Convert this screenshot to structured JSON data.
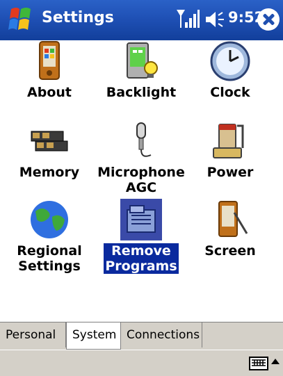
{
  "titlebar": {
    "title": "Settings",
    "time": "9:52"
  },
  "apps": [
    {
      "label": "About"
    },
    {
      "label": "Backlight"
    },
    {
      "label": "Clock"
    },
    {
      "label": "Memory"
    },
    {
      "label": "Microphone\nAGC"
    },
    {
      "label": "Power"
    },
    {
      "label": "Regional\nSettings"
    },
    {
      "label": "Remove\nPrograms",
      "selected": true
    },
    {
      "label": "Screen"
    }
  ],
  "tabs": [
    {
      "label": "Personal"
    },
    {
      "label": "System",
      "active": true
    },
    {
      "label": "Connections"
    }
  ],
  "colors": {
    "title_bar": "#1e4fb3",
    "selection": "#0a2a9e",
    "chrome": "#d4d0c8"
  }
}
